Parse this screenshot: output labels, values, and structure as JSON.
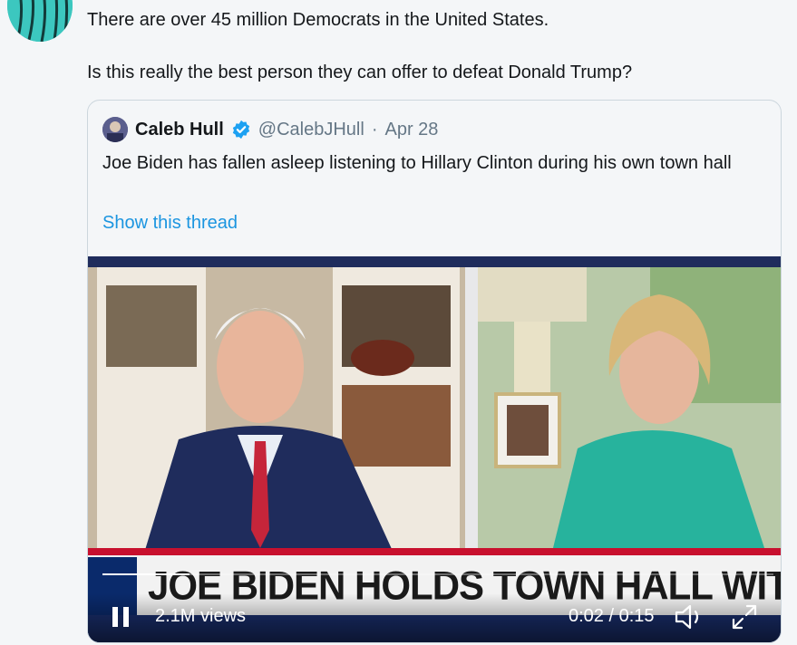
{
  "tweet": {
    "paragraphs": [
      "There are over 45 million Democrats in the United States.",
      "Is this really the best person they can offer to defeat Donald Trump?"
    ]
  },
  "quoted": {
    "name": "Caleb Hull",
    "handle": "@CalebJHull",
    "separator": "·",
    "date": "Apr 28",
    "text": "Joe Biden has fallen asleep listening to Hillary Clinton during his own town hall",
    "show_thread": "Show this thread"
  },
  "video": {
    "headline": "JOE BIDEN HOLDS TOWN HALL WITH HILLARY CL",
    "views": "2.1M views",
    "current_time": "0:02",
    "time_sep": "/",
    "duration": "0:15",
    "progress": 0.13
  },
  "colors": {
    "link": "#1b95e0",
    "verified": "#1da1f2",
    "fox_red": "#c8102e"
  },
  "icons": [
    "pause-icon",
    "volume-icon",
    "fullscreen-icon",
    "verified-icon"
  ]
}
